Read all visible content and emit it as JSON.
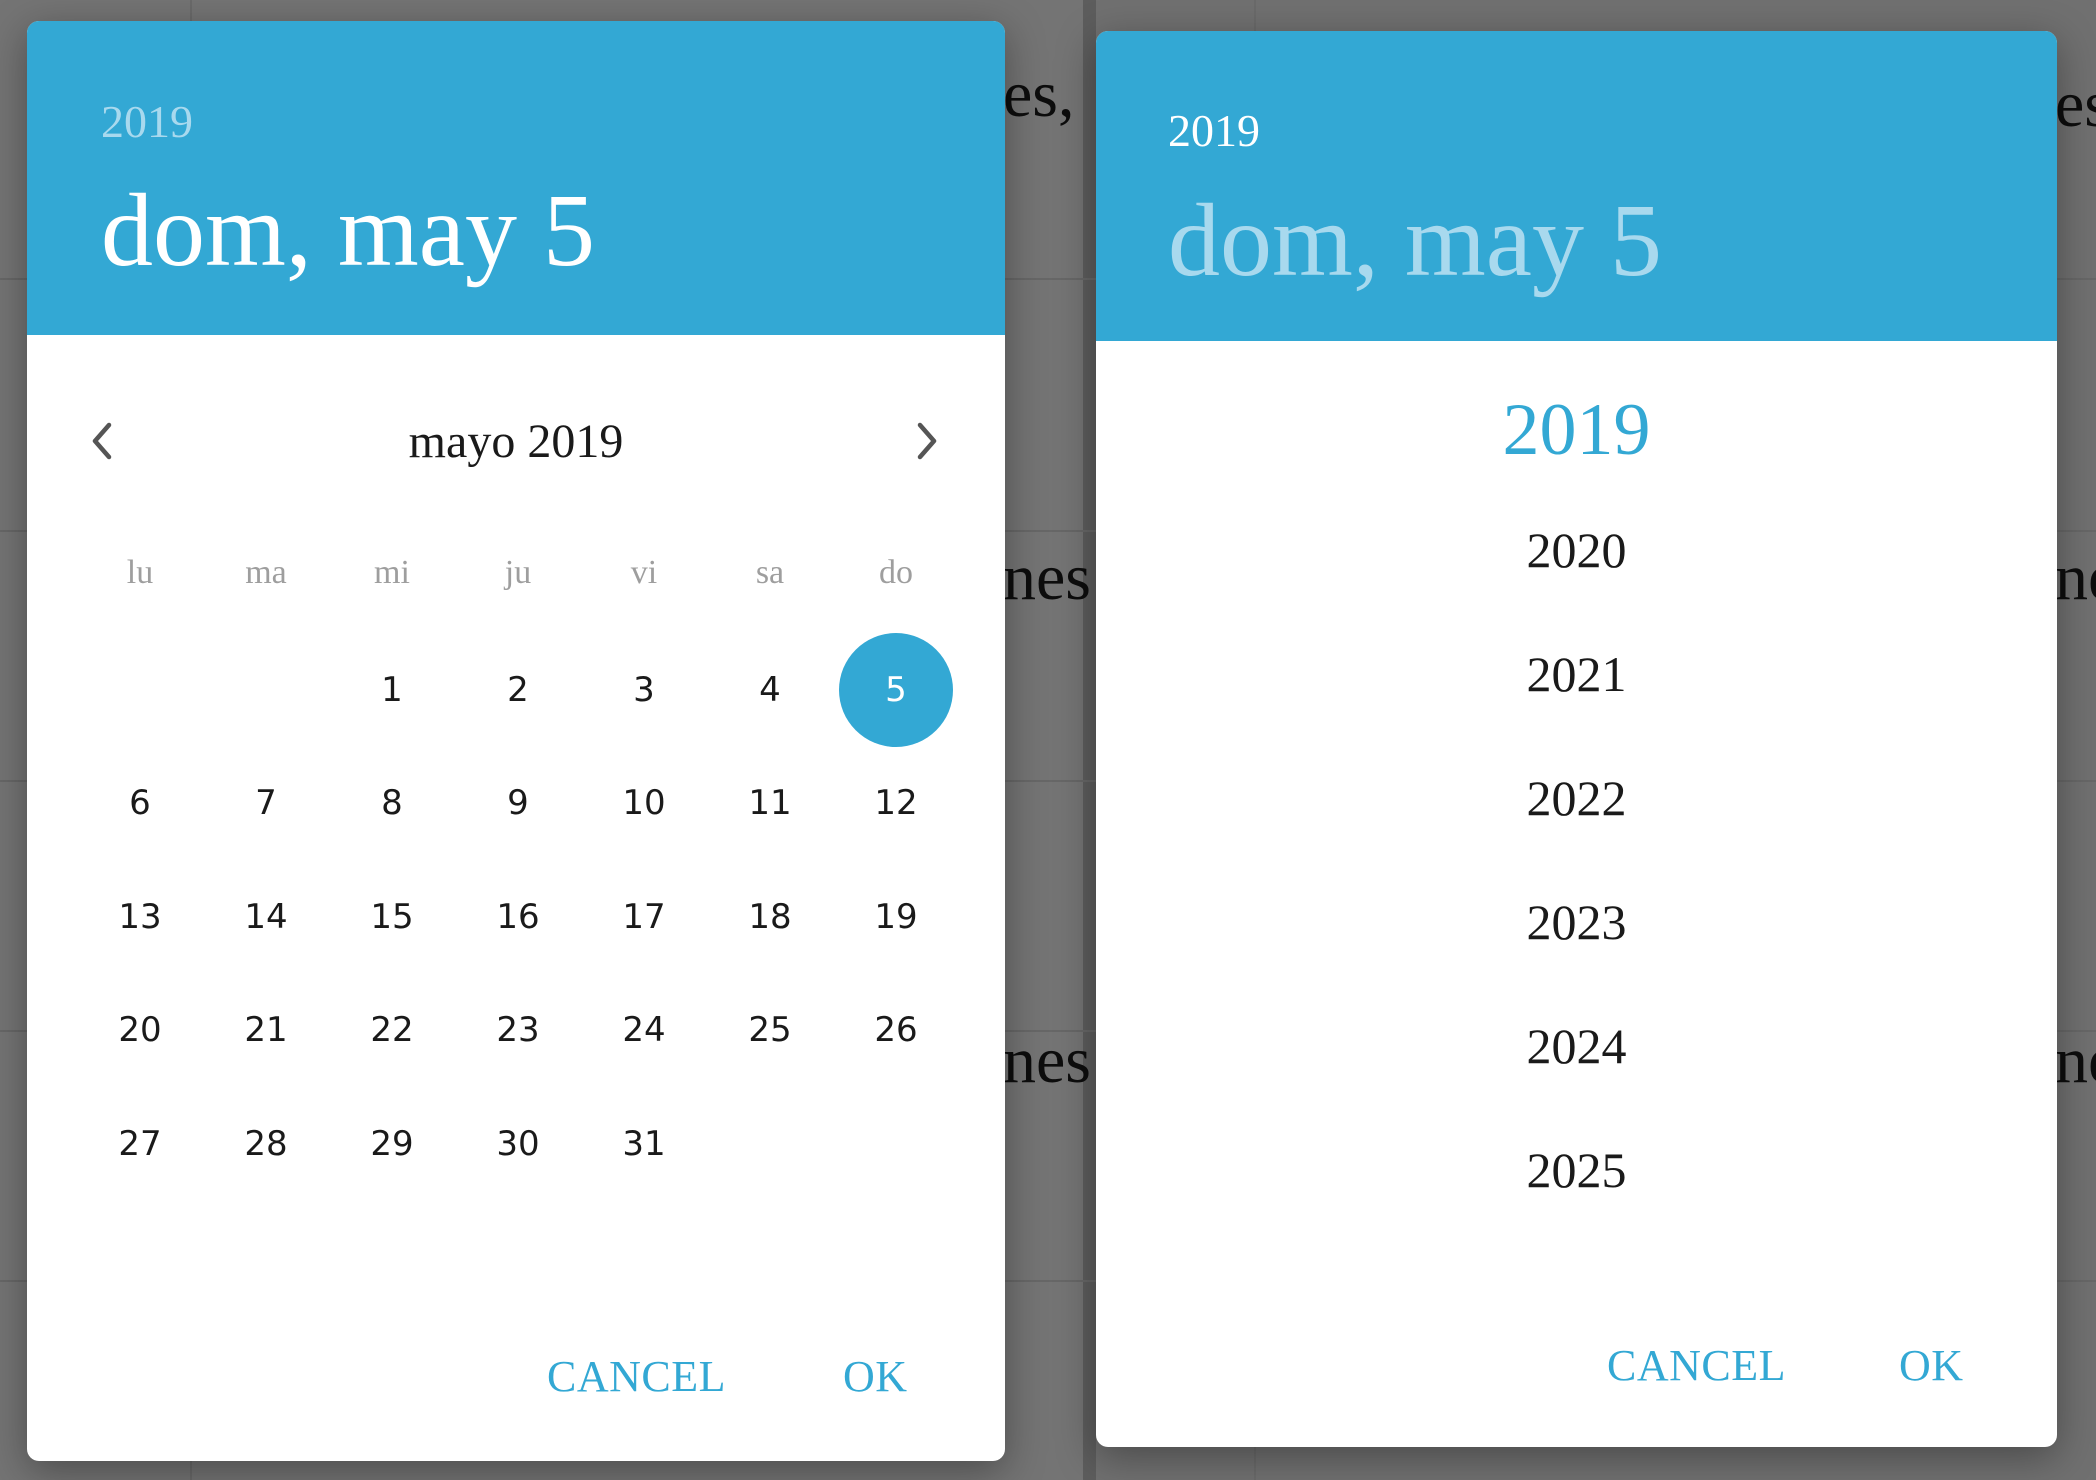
{
  "colors": {
    "accent": "#33a8d4",
    "header_muted_text": "#a8d9ee",
    "overlay": "#6e6e6e"
  },
  "background": {
    "fragments": [
      "es,",
      "nes",
      "nes",
      "es",
      "ne",
      "ne"
    ]
  },
  "calendar_dialog": {
    "header": {
      "year": "2019",
      "date": "dom, may 5"
    },
    "month_nav": {
      "prev_icon": "chevron-left-icon",
      "next_icon": "chevron-right-icon",
      "title": "mayo 2019"
    },
    "weekdays": [
      "lu",
      "ma",
      "mi",
      "ju",
      "vi",
      "sa",
      "do"
    ],
    "weeks": [
      [
        "",
        "",
        "1",
        "2",
        "3",
        "4",
        "5"
      ],
      [
        "6",
        "7",
        "8",
        "9",
        "10",
        "11",
        "12"
      ],
      [
        "13",
        "14",
        "15",
        "16",
        "17",
        "18",
        "19"
      ],
      [
        "20",
        "21",
        "22",
        "23",
        "24",
        "25",
        "26"
      ],
      [
        "27",
        "28",
        "29",
        "30",
        "31",
        "",
        ""
      ]
    ],
    "selected_day": "5",
    "actions": {
      "cancel": "CANCEL",
      "ok": "OK"
    }
  },
  "year_dialog": {
    "header": {
      "year": "2019",
      "date": "dom, may 5"
    },
    "years": [
      "2019",
      "2020",
      "2021",
      "2022",
      "2023",
      "2024",
      "2025"
    ],
    "selected_year": "2019",
    "actions": {
      "cancel": "CANCEL",
      "ok": "OK"
    }
  }
}
